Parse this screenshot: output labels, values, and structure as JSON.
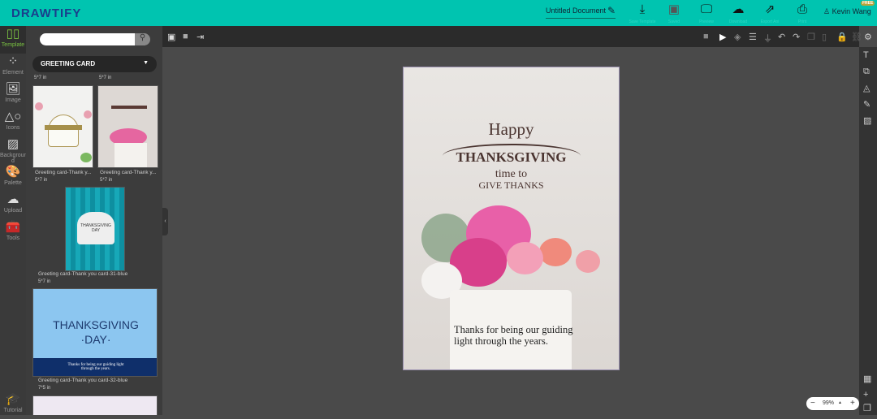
{
  "app": {
    "logo": "DRAWTIFY",
    "document_title": "Untitled Document",
    "user": "Kevin Wang",
    "plan_badge": "FREE"
  },
  "toolbar": [
    {
      "label": "Save Template",
      "icon": "download-icon"
    },
    {
      "label": "Saved",
      "icon": "save-icon"
    },
    {
      "label": "Preview",
      "icon": "monitor-icon"
    },
    {
      "label": "Download",
      "icon": "cloud-download-icon"
    },
    {
      "label": "Export Ani",
      "icon": "export-icon"
    },
    {
      "label": "Print",
      "icon": "print-icon"
    }
  ],
  "rail": [
    {
      "label": "Template",
      "glyph": "▯▯"
    },
    {
      "label": "Element",
      "glyph": "⁘"
    },
    {
      "label": "Image",
      "glyph": "🖼"
    },
    {
      "label": "Icons",
      "glyph": "△○"
    },
    {
      "label": "Backgroun d",
      "glyph": "▨"
    },
    {
      "label": "Palette",
      "glyph": "🎨"
    },
    {
      "label": "Upload",
      "glyph": "☁"
    },
    {
      "label": "Tools",
      "glyph": "🧰"
    }
  ],
  "tutorial": "Tutorial",
  "panel": {
    "search_placeholder": "",
    "category": "GREETING CARD",
    "top_sizes": [
      "5*7 in",
      "5*7 in"
    ],
    "templates": [
      {
        "caption": "Greeting card-Thank y...",
        "size": "5*7 in"
      },
      {
        "caption": "Greeting card-Thank y...",
        "size": "5*7 in"
      },
      {
        "caption": "Greeting card-Thank you card-31-blue",
        "size": "5*7 in"
      },
      {
        "caption": "Greeting card-Thank you card-32-blue",
        "size": "7*5 in"
      }
    ]
  },
  "thumb_texts": {
    "t3_title": "THANKSGIVING",
    "t3_sub": "DAY",
    "t4_title": "THANKSGIVING",
    "t4_sub": "·DAY·",
    "t4_msg": "Thanks for being our guiding light through the years."
  },
  "card": {
    "happy": "Happy",
    "thanksgiving": "THANKSGIVING",
    "time_to": "time to",
    "give_thanks": "GIVE THANKS",
    "message_line1": "Thanks for being our guiding",
    "message_line2": "light through the years."
  },
  "zoom": {
    "value": "99%"
  }
}
